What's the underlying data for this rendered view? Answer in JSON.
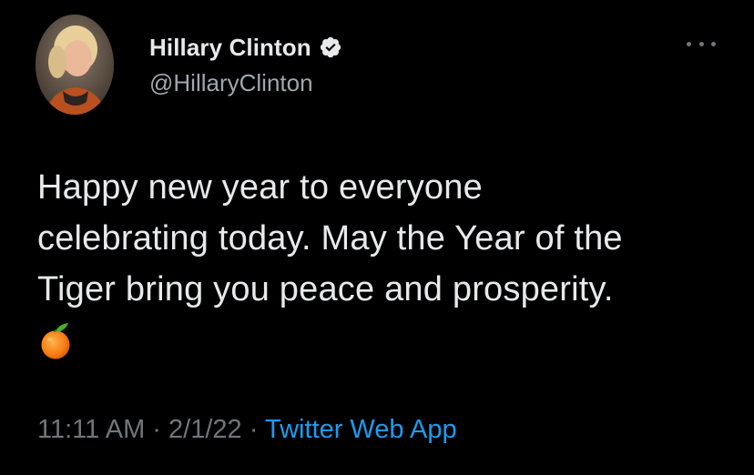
{
  "author": {
    "display_name": "Hillary Clinton",
    "handle": "@HillaryClinton",
    "verified": true,
    "avatar_icon": "profile-photo"
  },
  "tweet": {
    "text_lines": [
      "Happy new year to everyone",
      "celebrating today. May the Year of the",
      "Tiger bring you peace and prosperity."
    ],
    "emoji": "tangerine-emoji"
  },
  "meta": {
    "time": "11:11 AM",
    "separator": "·",
    "date": "2/1/22",
    "source_app": "Twitter Web App"
  },
  "menu": {
    "icon": "more-options-icon"
  },
  "colors": {
    "background": "#000000",
    "text_primary": "#e7e9ea",
    "text_secondary": "#71767b",
    "accent": "#1d9bf0"
  }
}
